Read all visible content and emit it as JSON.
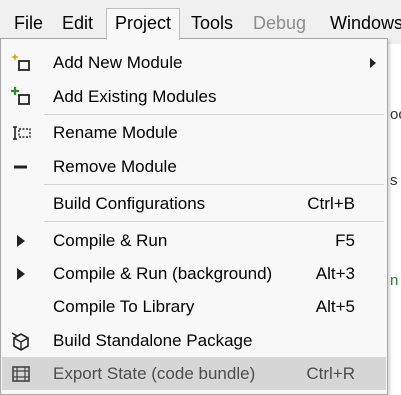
{
  "menubar": {
    "items": [
      {
        "label": "File",
        "state": "normal"
      },
      {
        "label": "Edit",
        "state": "normal"
      },
      {
        "label": "Project",
        "state": "active"
      },
      {
        "label": "Tools",
        "state": "normal"
      },
      {
        "label": "Debug",
        "state": "disabled"
      },
      {
        "label": "Windows",
        "state": "normal"
      }
    ]
  },
  "background_fragments": [
    "oc",
    "s",
    "n"
  ],
  "menu": {
    "items": [
      {
        "label": "Add New Module",
        "shortcut": "",
        "icon": "add-new-module-icon",
        "submenu": true
      },
      {
        "label": "Add Existing Modules",
        "shortcut": "",
        "icon": "add-existing-modules-icon"
      },
      {
        "label": "Rename Module",
        "shortcut": "",
        "icon": "rename-module-icon"
      },
      {
        "label": "Remove Module",
        "shortcut": "",
        "icon": "minus-icon"
      },
      {
        "label": "Build Configurations",
        "shortcut": "Ctrl+B",
        "icon": ""
      },
      {
        "label": "Compile & Run",
        "shortcut": "F5",
        "icon": "play-icon"
      },
      {
        "label": "Compile & Run (background)",
        "shortcut": "Alt+3",
        "icon": "play-icon"
      },
      {
        "label": "Compile To Library",
        "shortcut": "Alt+5",
        "icon": ""
      },
      {
        "label": "Build Standalone Package",
        "shortcut": "",
        "icon": "package-icon"
      },
      {
        "label": "Export State (code bundle)",
        "shortcut": "Ctrl+R",
        "icon": "export-grid-icon",
        "highlighted": true
      }
    ]
  },
  "colors": {
    "menubar_bg": "#f0f0f0",
    "menu_bg": "#f8f8f8",
    "highlight": "#d6d6d6",
    "disabled_text": "#8d8d8d",
    "add_icon_star": "#d9a400",
    "add_icon_plus": "#2e8b2e"
  }
}
